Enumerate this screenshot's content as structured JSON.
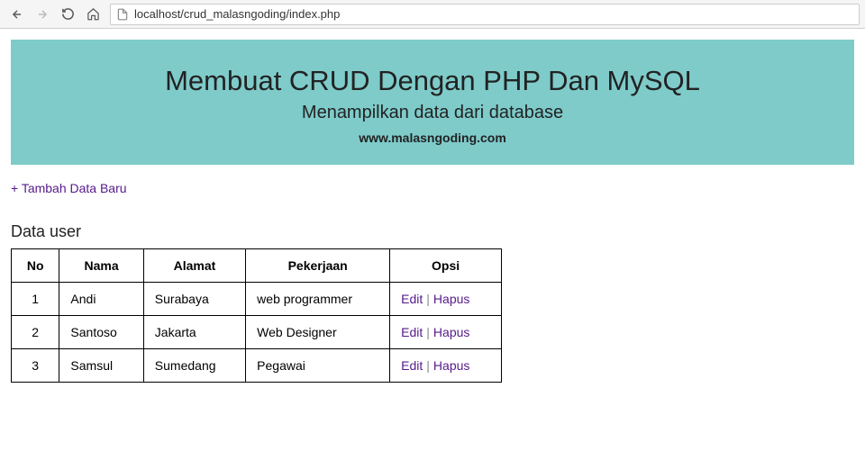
{
  "browser": {
    "url": "localhost/crud_malasngoding/index.php"
  },
  "banner": {
    "title": "Membuat CRUD Dengan PHP Dan MySQL",
    "subtitle": "Menampilkan data dari database",
    "site": "www.malasngoding.com"
  },
  "content": {
    "add_link": "+ Tambah Data Baru",
    "section_title": "Data user"
  },
  "table": {
    "headers": {
      "no": "No",
      "nama": "Nama",
      "alamat": "Alamat",
      "pekerjaan": "Pekerjaan",
      "opsi": "Opsi"
    },
    "actions": {
      "edit": "Edit",
      "hapus": "Hapus"
    },
    "rows": [
      {
        "no": "1",
        "nama": "Andi",
        "alamat": "Surabaya",
        "pekerjaan": "web programmer"
      },
      {
        "no": "2",
        "nama": "Santoso",
        "alamat": "Jakarta",
        "pekerjaan": "Web Designer"
      },
      {
        "no": "3",
        "nama": "Samsul",
        "alamat": "Sumedang",
        "pekerjaan": "Pegawai"
      }
    ]
  }
}
